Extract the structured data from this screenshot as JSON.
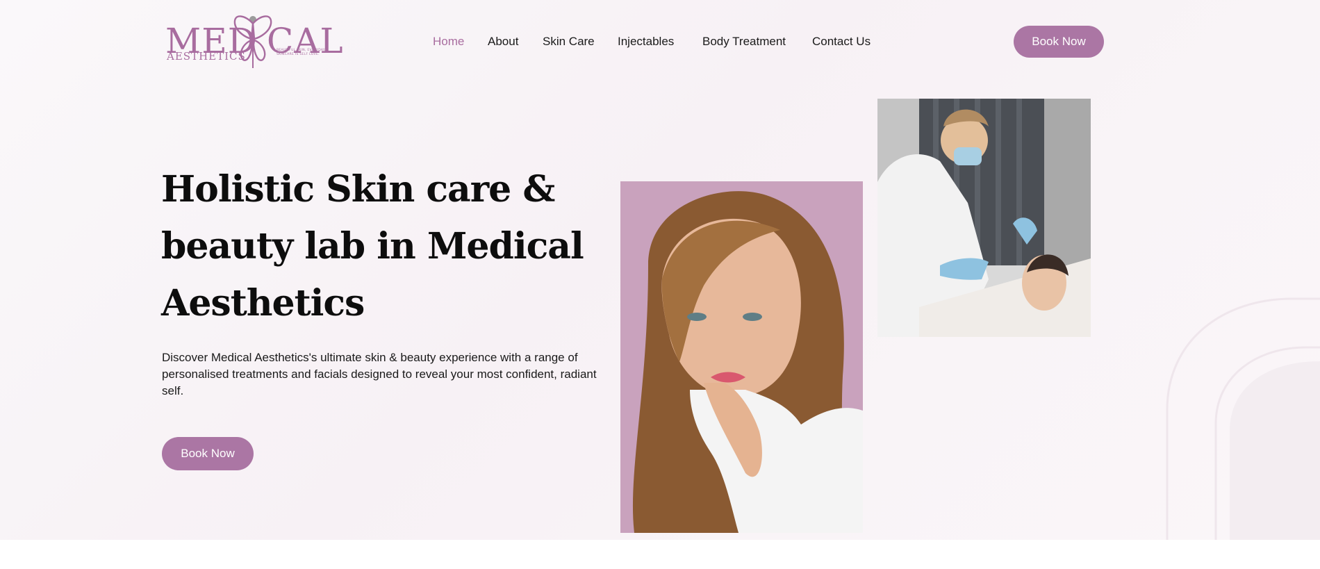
{
  "brand": {
    "logo_main_left": "MED",
    "logo_main_right": "CAL",
    "logo_sub": "AESTHETICS",
    "logo_tagline": "BEAUTIFUL SKIN, EVERYDAY. SKINCARE IS SELF LOVE.",
    "color": "#a86c9f"
  },
  "nav": {
    "items": [
      {
        "label": "Home",
        "active": true
      },
      {
        "label": "About"
      },
      {
        "label": "Skin Care"
      },
      {
        "label": "Injectables"
      },
      {
        "label": "Body Treatment"
      },
      {
        "label": "Contact Us"
      }
    ]
  },
  "header": {
    "cta_label": "Book Now"
  },
  "hero": {
    "headline_line1": "Holistic Skin care &",
    "headline_line2": "beauty lab in Medical",
    "headline_line3": "Aesthetics",
    "description": "Discover Medical Aesthetics's ultimate skin & beauty experience with a range of personalised treatments and facials designed to reveal your most confident, radiant self.",
    "cta_label": "Book Now"
  },
  "colors": {
    "accent": "#ab76a4",
    "background": "#f8f3f7",
    "photo_backdrop": "#c9a0bb"
  },
  "icons": [
    "butterfly-logo-icon"
  ]
}
